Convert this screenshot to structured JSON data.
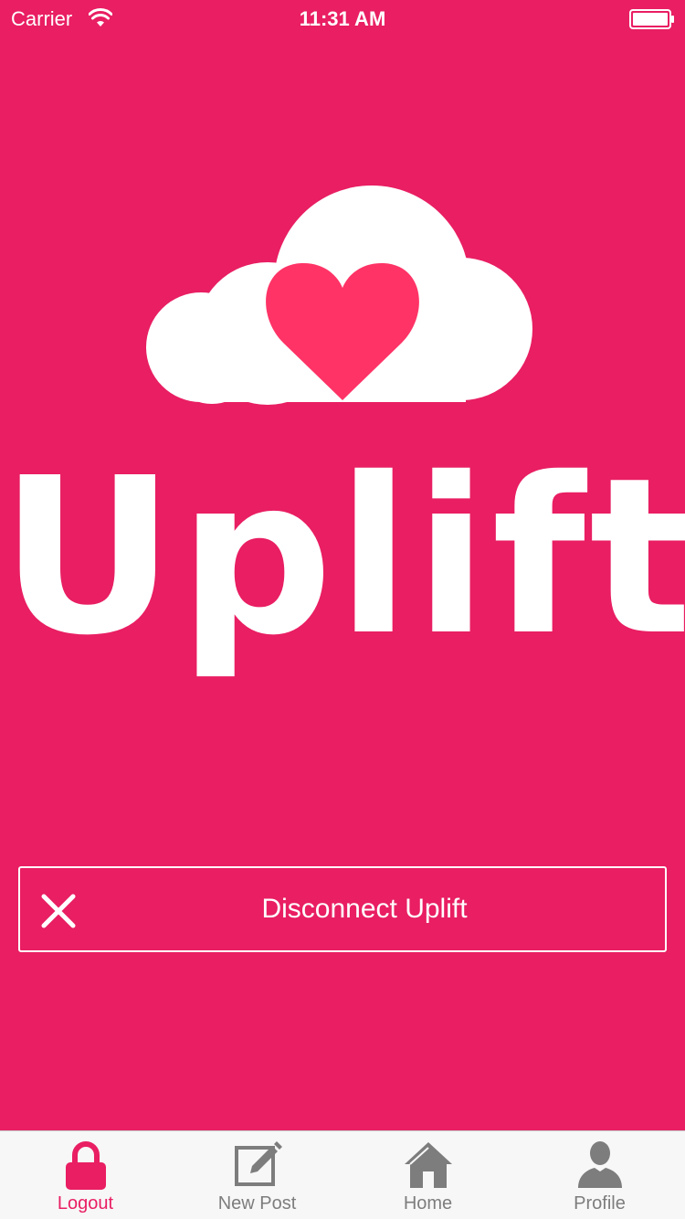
{
  "status_bar": {
    "carrier": "Carrier",
    "time": "11:31 AM",
    "wifi_icon": "wifi-icon",
    "battery_icon": "battery-icon"
  },
  "logo": {
    "wordmark": "Uplift",
    "icon": "cloud-heart-icon"
  },
  "disconnect": {
    "label": "Disconnect Uplift",
    "icon": "close-icon"
  },
  "tab_bar": {
    "tabs": [
      {
        "label": "Logout",
        "icon": "lock-icon",
        "active": true
      },
      {
        "label": "New Post",
        "icon": "compose-icon",
        "active": false
      },
      {
        "label": "Home",
        "icon": "home-icon",
        "active": false
      },
      {
        "label": "Profile",
        "icon": "person-icon",
        "active": false
      }
    ]
  },
  "colors": {
    "background": "#E91E63",
    "heart": "#FF3366",
    "active_tab": "#E91E63",
    "inactive_tab": "#7D7D7D",
    "tab_bar_bg": "#F7F7F7"
  }
}
